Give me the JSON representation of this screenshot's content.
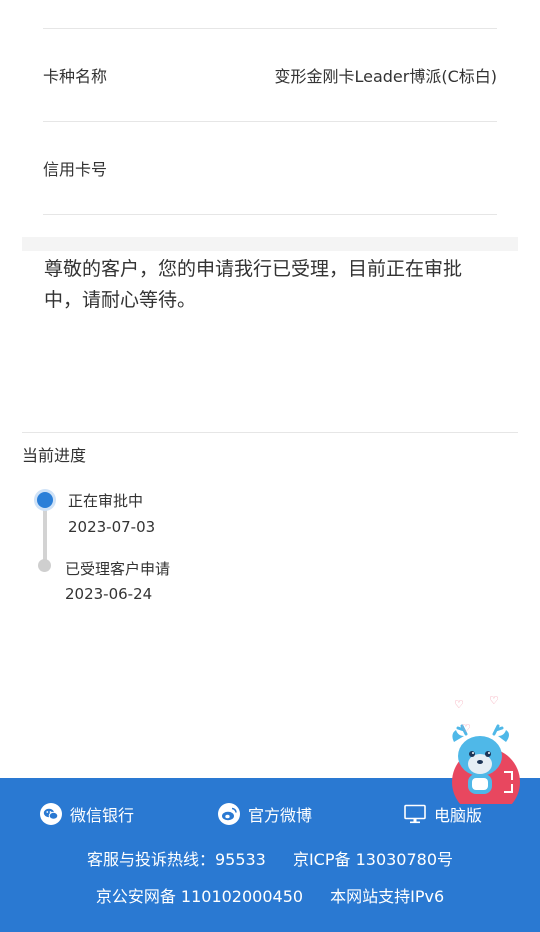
{
  "card_info": {
    "card_type_label": "卡种名称",
    "card_type_value": "变形金刚卡Leader博派(C标白)",
    "card_number_label": "信用卡号",
    "card_number_value": ""
  },
  "notice": {
    "text": "尊敬的客户，您的申请我行已受理，目前正在审批中，请耐心等待。"
  },
  "progress": {
    "title": "当前进度",
    "steps": [
      {
        "status": "正在审批中",
        "date": "2023-07-03",
        "active": true
      },
      {
        "status": "已受理客户申请",
        "date": "2023-06-24",
        "active": false
      }
    ]
  },
  "footer": {
    "links": [
      {
        "label": "微信银行",
        "icon": "wechat-icon"
      },
      {
        "label": "官方微博",
        "icon": "weibo-icon"
      },
      {
        "label": "电脑版",
        "icon": "desktop-icon"
      }
    ],
    "hotline_text": "客服与投诉热线：95533",
    "icp_text": "京ICP备 13030780号",
    "police_record_text": "京公安网备 110102000450",
    "ipv6_text": "本网站支持IPv6"
  },
  "colors": {
    "accent": "#2b7fd8",
    "footer_bg": "#2a79d2",
    "mascot_body": "#4fb8e8",
    "float_button": "#e8475f"
  }
}
